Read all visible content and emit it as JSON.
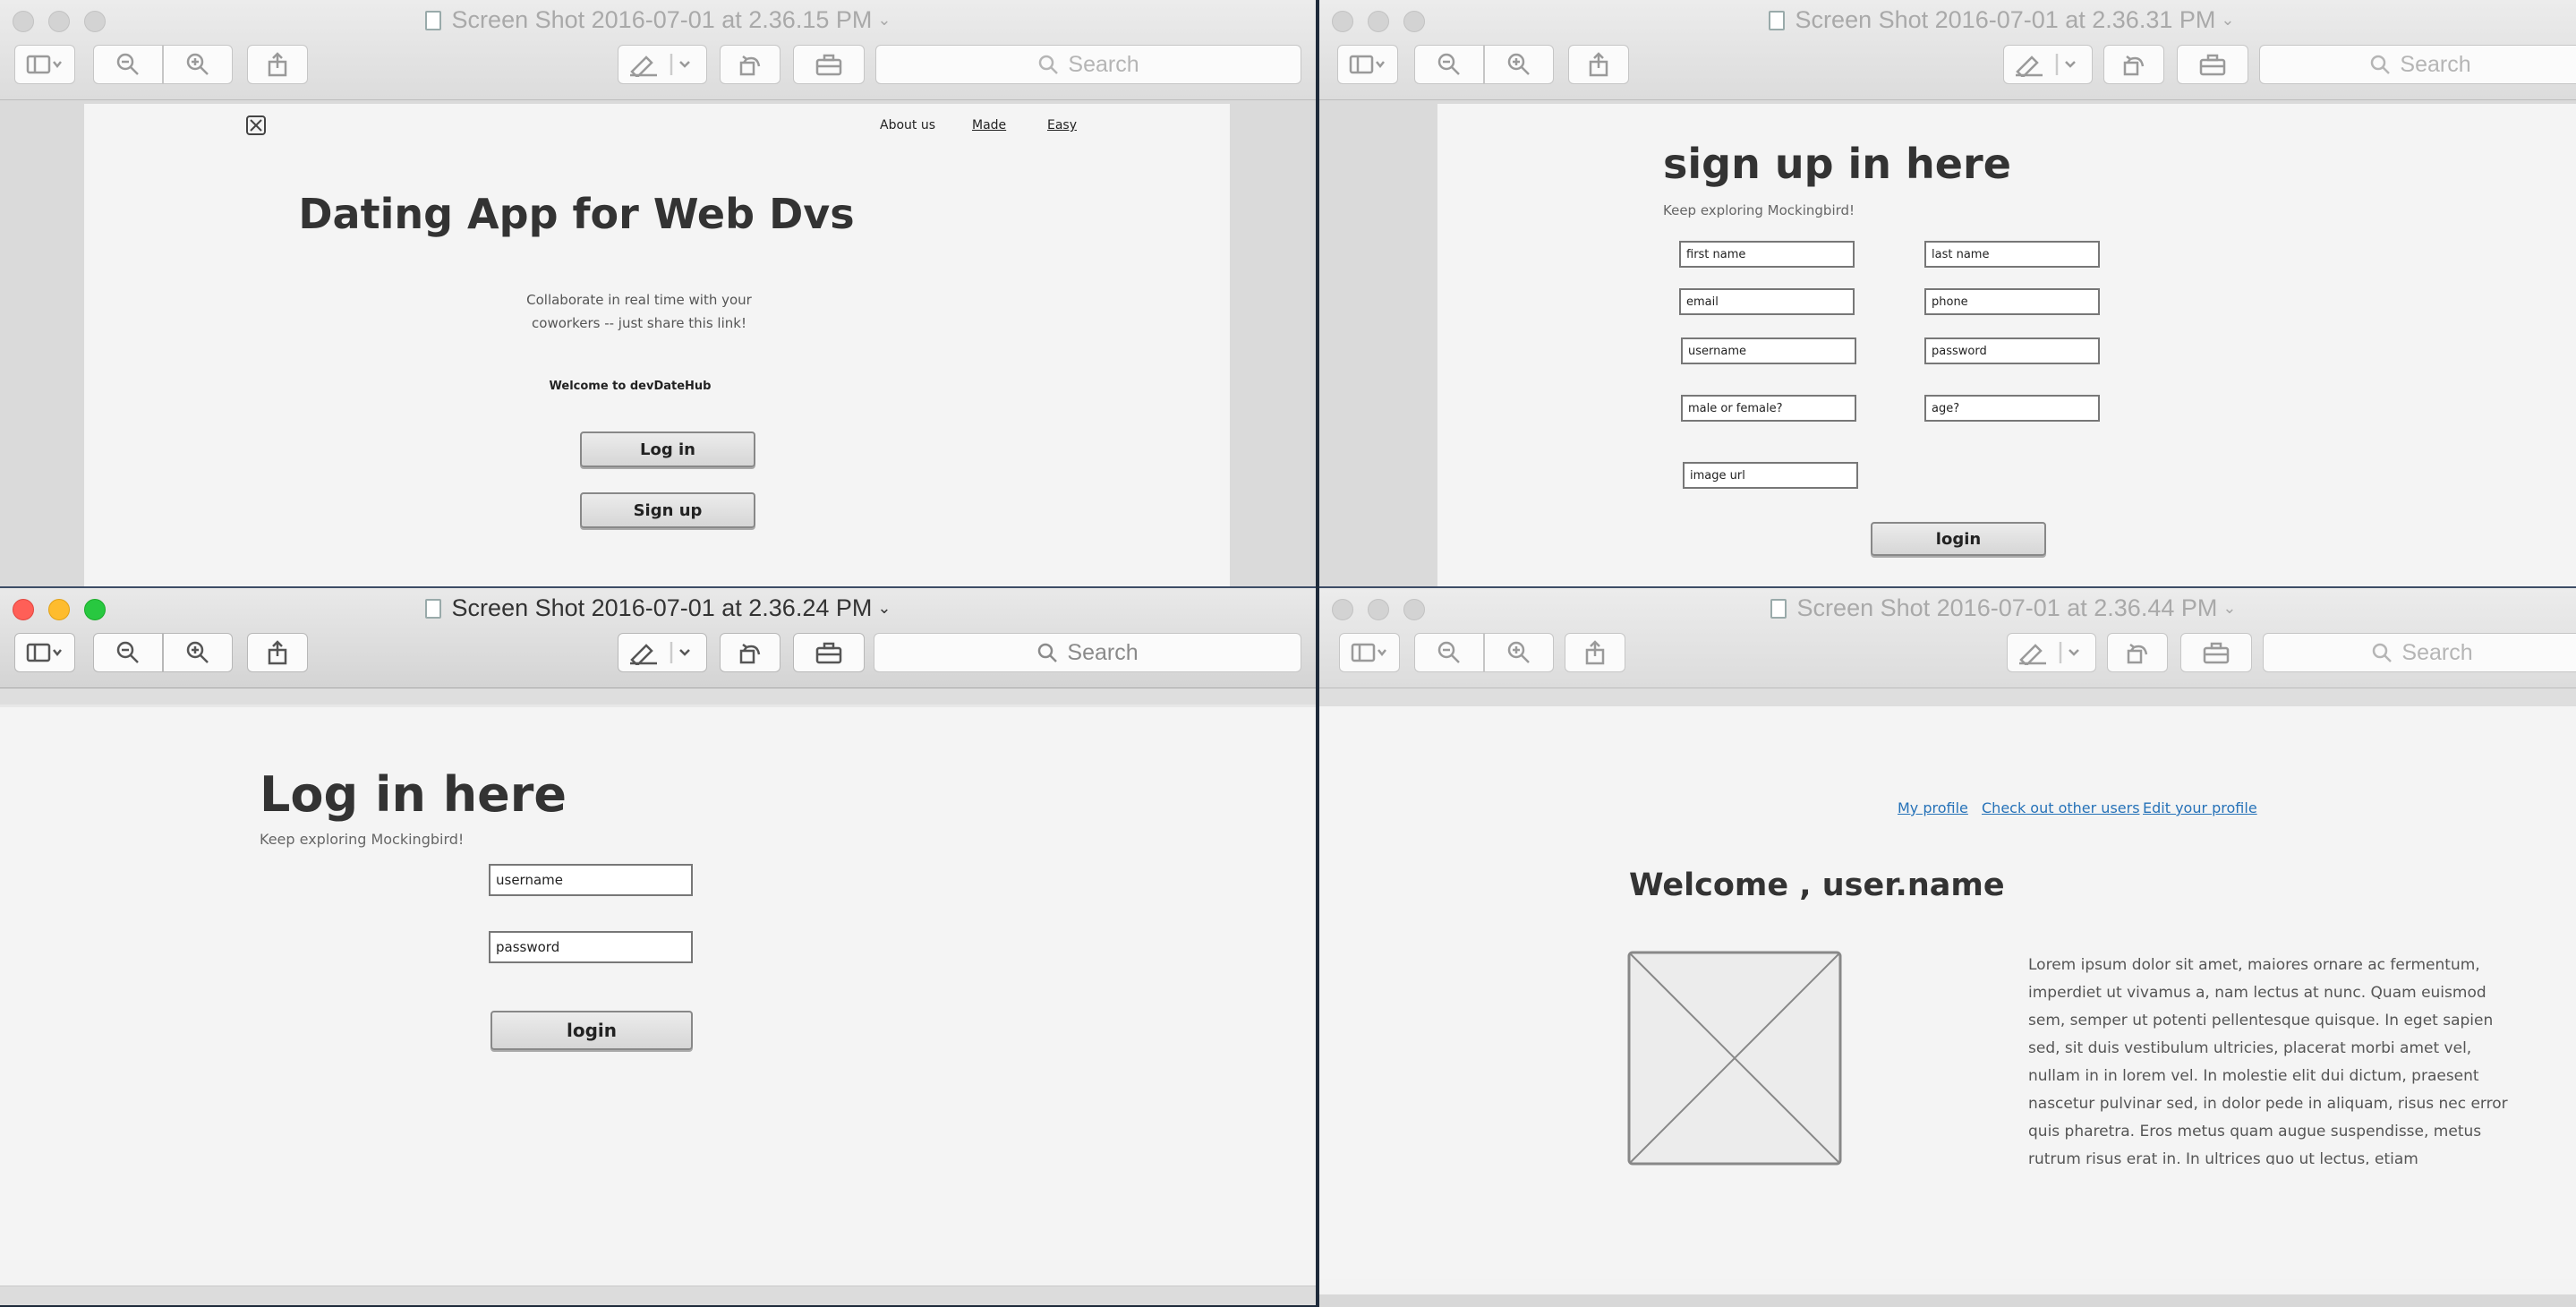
{
  "windows": {
    "w1": {
      "title": "Screen Shot 2016-07-01 at 2.36.15 PM",
      "search_placeholder": "Search",
      "page": {
        "nav": [
          "About us",
          "Made",
          "Easy"
        ],
        "heading": "Dating App for Web Dvs",
        "subtext_line1": "Collaborate in real time with your",
        "subtext_line2": "coworkers -- just share this link!",
        "welcome": "Welcome  to devDateHub",
        "login_button": "Log in",
        "signup_button": "Sign up"
      }
    },
    "w2": {
      "title": "Screen Shot 2016-07-01 at 2.36.31 PM",
      "search_placeholder": "Search",
      "page": {
        "heading": "sign up in here",
        "subheading": "Keep exploring Mockingbird!",
        "fields": {
          "first_name": "first name",
          "last_name": "last name",
          "email": "email",
          "phone": "phone",
          "username": "username",
          "password": "password",
          "gender": "male or female?",
          "age": "age?",
          "image_url": "image url"
        },
        "login_button": "login"
      }
    },
    "w3": {
      "title": "Screen Shot 2016-07-01 at 2.36.24 PM",
      "search_placeholder": "Search",
      "page": {
        "heading": "Log in here",
        "subheading": "Keep exploring Mockingbird!",
        "username_field": "username",
        "password_field": "password",
        "login_button": "login"
      }
    },
    "w4": {
      "title": "Screen Shot 2016-07-01 at 2.36.44 PM",
      "search_placeholder": "Search",
      "page": {
        "links": [
          "My profile",
          "Check out other users",
          "Edit your profile"
        ],
        "heading": "Welcome , user.name",
        "body_lines": [
          "Lorem ipsum dolor sit amet, maiores ornare ac fermentum,",
          "imperdiet ut vivamus a, nam lectus at nunc. Quam euismod",
          "sem, semper ut potenti pellentesque quisque. In eget sapien",
          "sed, sit duis vestibulum ultricies, placerat morbi amet vel,",
          "nullam in in lorem vel. In molestie elit dui dictum, praesent",
          "nascetur pulvinar sed, in dolor pede in aliquam, risus nec error",
          "quis pharetra. Eros metus quam augue suspendisse, metus",
          "rutrum risus erat in.  In ultrices quo ut lectus, etiam"
        ]
      }
    }
  },
  "icons": {
    "sidebar": "sidebar-toggle-icon",
    "zoom_out": "zoom-out-icon",
    "zoom_in": "zoom-in-icon",
    "share": "share-icon",
    "markup": "markup-pen-icon",
    "rotate": "rotate-icon",
    "toolbox": "toolbox-icon",
    "search": "search-icon"
  },
  "colors": {
    "link": "#2672b8",
    "close": "#ff5f57",
    "minimize": "#febc2e",
    "zoom": "#28c840"
  }
}
